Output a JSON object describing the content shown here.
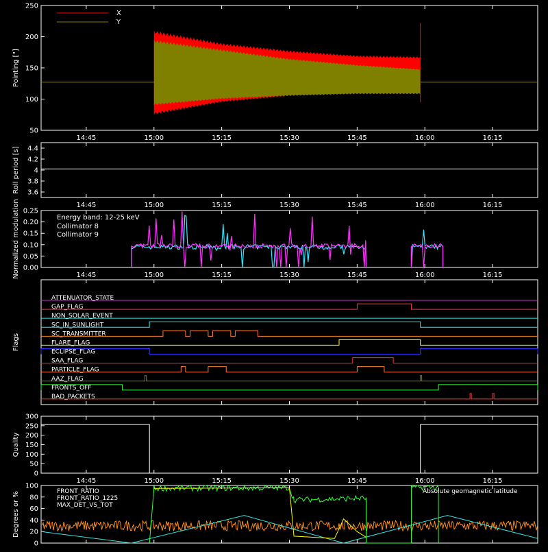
{
  "colors": {
    "background": "#000000",
    "axes": "#ffffff",
    "x": "#ff0000",
    "y": "#808000",
    "collimator_8": "#33e6ff",
    "collimator_9": "#ff33ff",
    "quality": "#ffffff",
    "front_ratio": "#ffff00",
    "front_ratio_1225": "#33ff33",
    "max_det_vs_tot": "#ff8c1a",
    "geomag": "#33e6e6"
  },
  "time_axis": {
    "range": [
      "14:35",
      "16:25"
    ],
    "ticks": [
      "14:45",
      "15:00",
      "15:15",
      "15:30",
      "15:45",
      "16:00",
      "16:15"
    ]
  },
  "chart_data": [
    {
      "type": "area",
      "id": "pointing",
      "ylabel": "Pointing [\"]",
      "ylim": [
        50,
        250
      ],
      "yticks": [
        50,
        100,
        150,
        200,
        250
      ],
      "baseline": 127,
      "active_range": [
        "15:00",
        "15:59"
      ],
      "series": [
        {
          "name": "X",
          "color_key": "x",
          "upper": [
            {
              "x": "15:00",
              "y": 210
            },
            {
              "x": "15:15",
              "y": 190
            },
            {
              "x": "15:30",
              "y": 178
            },
            {
              "x": "15:45",
              "y": 170
            },
            {
              "x": "15:59",
              "y": 168
            }
          ],
          "lower": [
            {
              "x": "15:00",
              "y": 75
            },
            {
              "x": "15:15",
              "y": 95
            },
            {
              "x": "15:30",
              "y": 105
            },
            {
              "x": "15:45",
              "y": 110
            },
            {
              "x": "15:59",
              "y": 112
            }
          ]
        },
        {
          "name": "Y",
          "color_key": "y",
          "upper": [
            {
              "x": "15:00",
              "y": 195
            },
            {
              "x": "15:15",
              "y": 180
            },
            {
              "x": "15:30",
              "y": 165
            },
            {
              "x": "15:45",
              "y": 155
            },
            {
              "x": "15:59",
              "y": 148
            }
          ],
          "lower": [
            {
              "x": "15:00",
              "y": 90
            },
            {
              "x": "15:15",
              "y": 100
            },
            {
              "x": "15:30",
              "y": 105
            },
            {
              "x": "15:45",
              "y": 108
            },
            {
              "x": "15:59",
              "y": 108
            }
          ]
        }
      ]
    },
    {
      "type": "line",
      "id": "roll",
      "ylabel": "Roll period [s]",
      "ylim": [
        3.5,
        4.5
      ],
      "yticks": [
        3.6,
        3.8,
        4.0,
        4.2,
        4.4
      ],
      "series": [
        {
          "name": "",
          "points": [
            {
              "x": "14:35",
              "y": 4.02
            },
            {
              "x": "16:25",
              "y": 4.02
            }
          ]
        }
      ]
    },
    {
      "type": "line",
      "id": "modulation",
      "ylabel": "Normalized modulation",
      "ylim": [
        0,
        0.25
      ],
      "yticks": [
        "0.00",
        "0.05",
        "0.10",
        "0.15",
        "0.20",
        "0.25"
      ],
      "annotation": "Energy band: 12-25 keV",
      "segments": [
        [
          "14:55",
          "15:47"
        ],
        [
          "15:57",
          "16:04"
        ]
      ],
      "series": [
        {
          "name": "Collimator 8",
          "color_key": "collimator_8",
          "level": 0.09
        },
        {
          "name": "Collimator 9",
          "color_key": "collimator_9",
          "level": 0.095
        }
      ]
    },
    {
      "type": "line",
      "id": "flags",
      "ylabel": "Flags",
      "flags": [
        {
          "name": "ATTENUATOR_STATE",
          "color": "#cc33cc",
          "on": []
        },
        {
          "name": "GAP_FLAG",
          "color": "#ff3333",
          "on": [
            [
              "15:45",
              "15:57"
            ]
          ]
        },
        {
          "name": "NON_SOLAR_EVENT",
          "color": "#33e6e6",
          "on": []
        },
        {
          "name": "SC_IN_SUNLIGHT",
          "color": "#33e6e6",
          "on": [
            [
              "14:59",
              "15:59"
            ]
          ]
        },
        {
          "name": "SC_TRANSMITTER",
          "color": "#ff7f33",
          "on": [
            [
              "15:02",
              "15:07"
            ],
            [
              "15:08",
              "15:12"
            ],
            [
              "15:13",
              "15:17"
            ],
            [
              "15:18",
              "15:23"
            ]
          ]
        },
        {
          "name": "FLARE_FLAG",
          "color": "#ffff33",
          "on": [
            [
              "15:41",
              "15:59"
            ]
          ]
        },
        {
          "name": "ECLIPSE_FLAG",
          "color": "#3333ff",
          "on": [
            [
              "14:35",
              "14:59"
            ],
            [
              "15:59",
              "16:25"
            ]
          ]
        },
        {
          "name": "SAA_FLAG",
          "color": "#ff3333",
          "on": [
            [
              "15:44",
              "15:53"
            ]
          ]
        },
        {
          "name": "PARTICLE_FLAG",
          "color": "#ff7f33",
          "on": [
            [
              "15:06",
              "15:07"
            ],
            [
              "15:12",
              "15:16"
            ],
            [
              "15:45",
              "15:51"
            ]
          ]
        },
        {
          "name": "AAZ_FLAG",
          "color": "#808000",
          "on": [
            [
              "14:58",
              "14:58"
            ],
            [
              "15:59",
              "15:59"
            ]
          ]
        },
        {
          "name": "FRONTS_OFF",
          "color": "#33ff33",
          "on": [
            [
              "14:35",
              "14:53"
            ],
            [
              "16:03",
              "16:25"
            ]
          ]
        },
        {
          "name": "BAD_PACKETS",
          "color": "#ff3333",
          "on": [
            [
              "16:10",
              "16:10"
            ],
            [
              "16:15",
              "16:15"
            ]
          ]
        }
      ]
    },
    {
      "type": "line",
      "id": "quality",
      "ylabel": "Quality",
      "ylim": [
        0,
        300
      ],
      "yticks": [
        0,
        50,
        100,
        150,
        200,
        250,
        300
      ],
      "series": [
        {
          "name": "",
          "points": [
            {
              "x": "14:35",
              "y": 256
            },
            {
              "x": "14:59",
              "y": 256
            },
            {
              "x": "14:59",
              "y": 0
            },
            {
              "x": "15:59",
              "y": 0
            },
            {
              "x": "15:59",
              "y": 256
            },
            {
              "x": "16:25",
              "y": 256
            }
          ]
        }
      ]
    },
    {
      "type": "line",
      "id": "ratios",
      "ylabel": "Degrees or %",
      "ylim": [
        0,
        100
      ],
      "yticks": [
        0,
        20,
        40,
        60,
        80,
        100
      ],
      "series": [
        {
          "name": "FRONT_RATIO",
          "color_key": "front_ratio",
          "points": [
            {
              "x": "15:00",
              "y": 95
            },
            {
              "x": "15:30",
              "y": 96
            },
            {
              "x": "15:31",
              "y": 12
            },
            {
              "x": "15:40",
              "y": 8
            },
            {
              "x": "15:42",
              "y": 42
            },
            {
              "x": "15:45",
              "y": 20
            },
            {
              "x": "15:47",
              "y": 10
            }
          ]
        },
        {
          "name": "FRONT_RATIO_1225",
          "color_key": "front_ratio_1225",
          "points": [
            {
              "x": "14:59",
              "y": 0
            },
            {
              "x": "15:00",
              "y": 95
            },
            {
              "x": "15:30",
              "y": 96
            },
            {
              "x": "15:31",
              "y": 75
            },
            {
              "x": "15:47",
              "y": 78
            },
            {
              "x": "15:47",
              "y": 0
            },
            {
              "x": "15:57",
              "y": 0
            },
            {
              "x": "15:57",
              "y": 97
            },
            {
              "x": "16:03",
              "y": 97
            },
            {
              "x": "16:03",
              "y": 0
            }
          ]
        },
        {
          "name": "MAX_DET_VS_TOT",
          "color_key": "max_det_vs_tot",
          "level": 30
        },
        {
          "name": "Absolute geomagnetic latitude",
          "color_key": "geomag",
          "points": [
            {
              "x": "14:35",
              "y": 20
            },
            {
              "x": "14:55",
              "y": 0
            },
            {
              "x": "15:20",
              "y": 48
            },
            {
              "x": "15:42",
              "y": 0
            },
            {
              "x": "16:05",
              "y": 48
            },
            {
              "x": "16:25",
              "y": 8
            }
          ]
        }
      ]
    }
  ]
}
